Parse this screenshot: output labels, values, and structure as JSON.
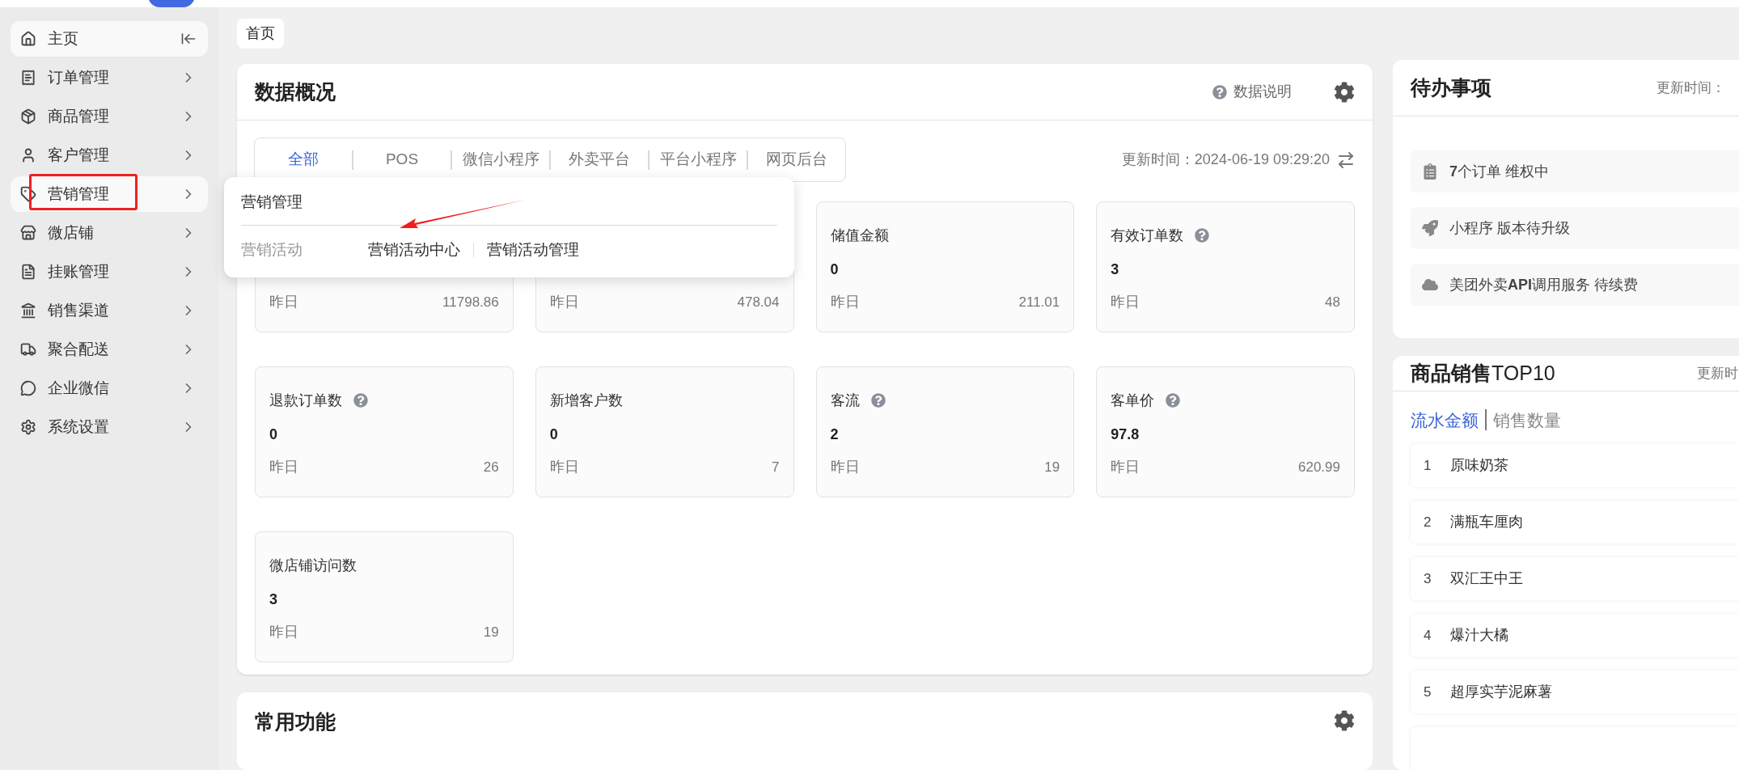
{
  "sidebar": {
    "items": [
      {
        "label": "主页",
        "selected": true,
        "collapse": true
      },
      {
        "label": "订单管理",
        "selected": false
      },
      {
        "label": "商品管理",
        "selected": false
      },
      {
        "label": "客户管理",
        "selected": false
      },
      {
        "label": "营销管理",
        "selected": true
      },
      {
        "label": "微店铺",
        "selected": false
      },
      {
        "label": "挂账管理",
        "selected": false
      },
      {
        "label": "销售渠道",
        "selected": false
      },
      {
        "label": "聚合配送",
        "selected": false
      },
      {
        "label": "企业微信",
        "selected": false
      },
      {
        "label": "系统设置",
        "selected": false
      }
    ]
  },
  "breadcrumb": "首页",
  "overview": {
    "title": "数据概况",
    "help_link": "数据说明",
    "tabs": [
      {
        "label": "全部",
        "selected": true
      },
      {
        "label": "POS",
        "selected": false
      },
      {
        "label": "微信小程序",
        "selected": false
      },
      {
        "label": "外卖平台",
        "selected": false
      },
      {
        "label": "平台小程序",
        "selected": false
      },
      {
        "label": "网页后台",
        "selected": false
      }
    ],
    "updated": "更新时间：2024-06-19 09:29:20",
    "stats": [
      {
        "yesterday_label": "昨日",
        "yesterday": "11798.86"
      },
      {
        "yesterday_label": "昨日",
        "yesterday": "478.04"
      },
      {
        "title": "储值金额",
        "help": false,
        "value": "0",
        "yesterday_label": "昨日",
        "yesterday": "211.01"
      },
      {
        "title": "有效订单数",
        "help": true,
        "value": "3",
        "yesterday_label": "昨日",
        "yesterday": "48"
      },
      {
        "title": "退款订单数",
        "help": true,
        "value": "0",
        "yesterday_label": "昨日",
        "yesterday": "26"
      },
      {
        "title": "新增客户数",
        "help": false,
        "value": "0",
        "yesterday_label": "昨日",
        "yesterday": "7"
      },
      {
        "title": "客流",
        "help": true,
        "value": "2",
        "yesterday_label": "昨日",
        "yesterday": "19"
      },
      {
        "title": "客单价",
        "help": true,
        "value": "97.8",
        "yesterday_label": "昨日",
        "yesterday": "620.99"
      },
      {
        "title": "微店铺访问数",
        "help": false,
        "value": "3",
        "yesterday_label": "昨日",
        "yesterday": "19"
      }
    ]
  },
  "flyout": {
    "title": "营销管理",
    "group_label": "营销活动",
    "links": [
      "营销活动中心",
      "营销活动管理"
    ]
  },
  "common": {
    "title": "常用功能"
  },
  "todo": {
    "title": "待办事项",
    "updated": "更新时间：",
    "items": [
      {
        "kind": "order",
        "text": "**7**个订单 维权中"
      },
      {
        "kind": "upgrade",
        "text": "小程序 版本待升级"
      },
      {
        "kind": "service",
        "text": "美团外卖**API**调用服务 待续费"
      }
    ]
  },
  "top": {
    "title": "商品销售",
    "title_suffix": "TOP10",
    "updated": "更新时",
    "tabs": [
      {
        "label": "流水金额",
        "selected": true
      },
      {
        "label": "销售数量",
        "selected": false
      }
    ],
    "rows": [
      {
        "rank": "1",
        "name": "原味奶茶"
      },
      {
        "rank": "2",
        "name": "满瓶车厘肉"
      },
      {
        "rank": "3",
        "name": "双汇王中王"
      },
      {
        "rank": "4",
        "name": "爆汁大橘"
      },
      {
        "rank": "5",
        "name": "超厚实芋泥麻薯"
      }
    ]
  }
}
